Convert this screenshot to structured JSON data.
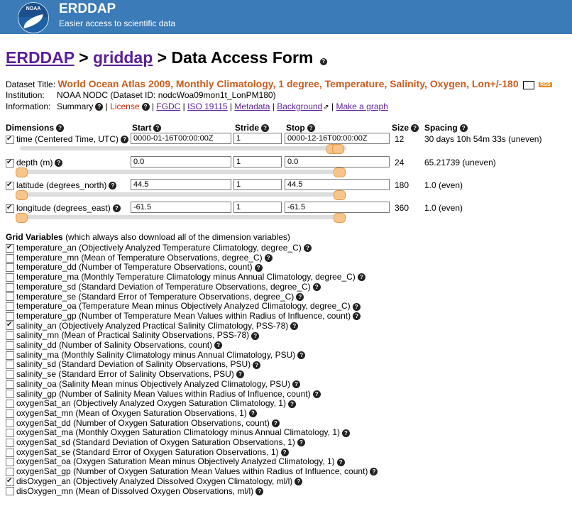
{
  "header": {
    "logo_text": "NOAA",
    "title": "ERDDAP",
    "subtitle": "Easier access to scientific data"
  },
  "breadcrumb": {
    "home": "ERDDAP",
    "sep1": ">",
    "section": "griddap",
    "sep2": ">",
    "page": "Data Access Form"
  },
  "dataset": {
    "title_label": "Dataset Title:",
    "title": "World Ocean Atlas 2009, Monthly Climatology, 1 degree, Temperature, Salinity, Oxygen, Lon+/-180",
    "rss_label": "RSS",
    "institution_label": "Institution:",
    "institution": "NOAA NODC",
    "dataset_id": "(Dataset ID: nodcWoa09mon1t_LonPM180)",
    "information_label": "Information:",
    "summary": "Summary",
    "license": "License",
    "fgdc": "FGDC",
    "iso": "ISO 19115",
    "metadata": "Metadata",
    "background": "Background",
    "make_graph": "Make a graph"
  },
  "dimensions": {
    "headers": {
      "dimensions": "Dimensions",
      "start": "Start",
      "stride": "Stride",
      "stop": "Stop",
      "size": "Size",
      "spacing": "Spacing"
    },
    "rows": [
      {
        "label": "time (Centered Time, UTC)",
        "start": "0000-01-16T00:00:00Z",
        "stride": "1",
        "stop": "0000-12-16T00:00:00Z",
        "size": "12",
        "spacing": "30 days 10h 54m 33s (uneven)",
        "checked": true
      },
      {
        "label": "depth (m)",
        "start": "0.0",
        "stride": "1",
        "stop": "0.0",
        "size": "24",
        "spacing": "65.21739 (uneven)",
        "checked": true
      },
      {
        "label": "latitude (degrees_north)",
        "start": "44.5",
        "stride": "1",
        "stop": "44.5",
        "size": "180",
        "spacing": "1.0 (even)",
        "checked": true
      },
      {
        "label": "longitude (degrees_east)",
        "start": "-61.5",
        "stride": "1",
        "stop": "-61.5",
        "size": "360",
        "spacing": "1.0 (even)",
        "checked": true
      }
    ]
  },
  "grid_variables": {
    "heading": "Grid Variables",
    "note": "(which always also download all of the dimension variables)",
    "items": [
      {
        "label": "temperature_an (Objectively Analyzed Temperature Climatology, degree_C)",
        "checked": true
      },
      {
        "label": "temperature_mn (Mean of Temperature Observations, degree_C)",
        "checked": false
      },
      {
        "label": "temperature_dd (Number of Temperature Observations, count)",
        "checked": false
      },
      {
        "label": "temperature_ma (Monthly Temperature Climatology minus Annual Climatology, degree_C)",
        "checked": false
      },
      {
        "label": "temperature_sd (Standard Deviation of Temperature Observations, degree_C)",
        "checked": false
      },
      {
        "label": "temperature_se (Standard Error of Temperature Observations, degree_C)",
        "checked": false
      },
      {
        "label": "temperature_oa (Temperature Mean minus Objectively Analyzed Climatology, degree_C)",
        "checked": false
      },
      {
        "label": "temperature_gp (Number of Temperature Mean Values within Radius of Influence, count)",
        "checked": false
      },
      {
        "label": "salinity_an (Objectively Analyzed Practical Salinity Climatology, PSS-78)",
        "checked": true
      },
      {
        "label": "salinity_mn (Mean of Practical Salinity Observations, PSS-78)",
        "checked": false
      },
      {
        "label": "salinity_dd (Number of Salinity Observations, count)",
        "checked": false
      },
      {
        "label": "salinity_ma (Monthly Salinity Climatology minus Annual Climatology, PSU)",
        "checked": false
      },
      {
        "label": "salinity_sd (Standard Deviation of Salinity Observations, PSU)",
        "checked": false
      },
      {
        "label": "salinity_se (Standard Error of Salinity Observations, PSU)",
        "checked": false
      },
      {
        "label": "salinity_oa (Salinity Mean minus Objectively Analyzed Climatology, PSU)",
        "checked": false
      },
      {
        "label": "salinity_gp (Number of Salinity Mean Values within Radius of Influence, count)",
        "checked": false
      },
      {
        "label": "oxygenSat_an (Objectively Analyzed Oxygen Saturation Climatology, 1)",
        "checked": false
      },
      {
        "label": "oxygenSat_mn (Mean of Oxygen Saturation Observations, 1)",
        "checked": false
      },
      {
        "label": "oxygenSat_dd (Number of Oxygen Saturation Observations, count)",
        "checked": false
      },
      {
        "label": "oxygenSat_ma (Monthly Oxygen Saturation Climatology minus Annual Climatology, 1)",
        "checked": false
      },
      {
        "label": "oxygenSat_sd (Standard Deviation of Oxygen Saturation Observations, 1)",
        "checked": false
      },
      {
        "label": "oxygenSat_se (Standard Error of Oxygen Saturation Observations, 1)",
        "checked": false
      },
      {
        "label": "oxygenSat_oa (Oxygen Saturation Mean minus Objectively Analyzed Climatology, 1)",
        "checked": false
      },
      {
        "label": "oxygenSat_gp (Number of Oxygen Saturation Mean Values within Radius of Influence, count)",
        "checked": false
      },
      {
        "label": "disOxygen_an (Objectively Analyzed Dissolved Oxygen Climatology, ml/l)",
        "checked": true
      },
      {
        "label": "disOxygen_mn (Mean of Dissolved Oxygen Observations, ml/l)",
        "checked": false
      }
    ]
  },
  "colors": {
    "header_bg": "#3b7bb7",
    "title_orange": "#cc5b1b",
    "link_purple": "#5b1f9a",
    "license_red": "#cc2200",
    "slider_handle": "#f7c48a"
  },
  "icons": {
    "help": "question-circle-icon",
    "mail": "envelope-icon",
    "rss": "rss-icon",
    "external": "external-link-icon",
    "logo": "noaa-logo-icon"
  }
}
